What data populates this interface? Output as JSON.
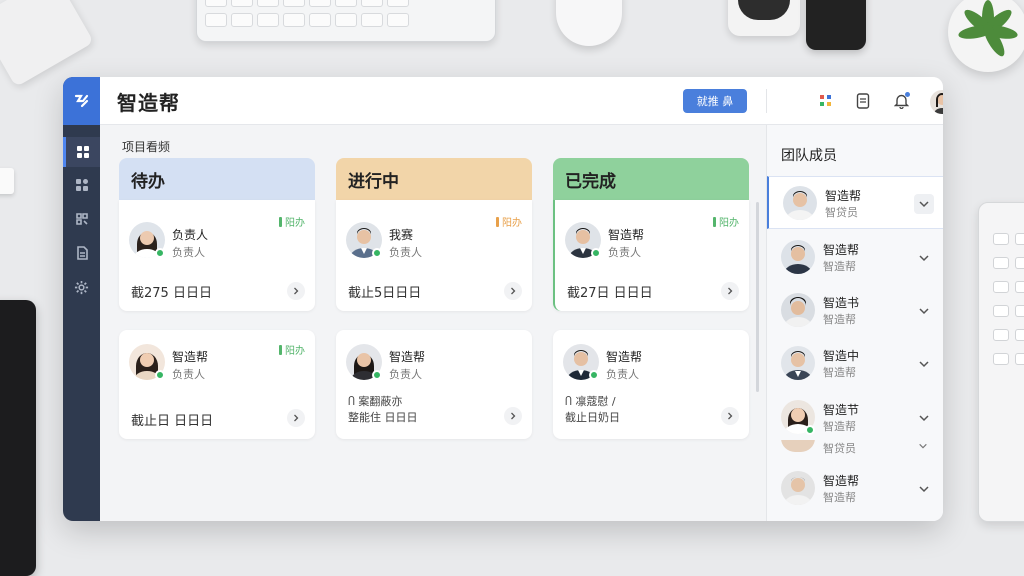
{
  "app": {
    "title": "智造帮"
  },
  "topbar": {
    "primary_button": "就推 鼻"
  },
  "board": {
    "section_label": "项目看频",
    "columns": [
      {
        "title": "待办",
        "color": "#d4e0f3"
      },
      {
        "title": "进行中",
        "color": "#f2d5a9"
      },
      {
        "title": "已完成",
        "color": "#8fd19c"
      }
    ],
    "cards": {
      "todo": [
        {
          "name": "负责人",
          "role": "负责人",
          "tag": "阳办",
          "due": "截275 日日日"
        },
        {
          "name": "智造帮",
          "role": "负责人",
          "tag": "阳办",
          "due": "截止日 日日日"
        }
      ],
      "inprogress": [
        {
          "name": "我赛",
          "role": "负责人",
          "tag": "阳办",
          "due": "截止5日日日"
        },
        {
          "name": "智造帮",
          "role": "负责人",
          "due_line1": "Ⴖ 案翻蔽亦",
          "due_line2": "整能住 日日日"
        }
      ],
      "done": [
        {
          "name": "智造帮",
          "role": "负责人",
          "tag": "阳办",
          "due": "截27日 日日日"
        },
        {
          "name": "智造帮",
          "role": "负责人",
          "due_line1": "Ⴖ 凛蔻慰 /",
          "due_line2": "截止日奶日"
        }
      ]
    },
    "tag_colors": {
      "todo": "#54b56c",
      "inprogress": "#e8a04a",
      "done": "#54b56c"
    }
  },
  "team": {
    "title": "团队成员",
    "members": [
      {
        "name": "智造帮",
        "role": "智贷员"
      },
      {
        "name": "智造帮",
        "role": "智造帮"
      },
      {
        "name": "智造书",
        "role": "智造帮"
      },
      {
        "name": "智造中",
        "role": "智造帮"
      },
      {
        "name": "智造节",
        "role": "智造帮"
      },
      {
        "name": "智造帮",
        "role": "智造帮"
      }
    ],
    "partial_role": "智贷员"
  }
}
